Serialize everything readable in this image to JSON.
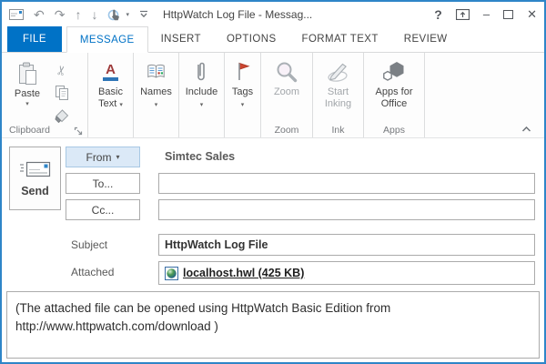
{
  "window": {
    "title": "HttpWatch Log File - Messag...",
    "controls": {
      "help": "?",
      "minimize": "–",
      "close": "✕"
    }
  },
  "glyphs": {
    "caret": "▾",
    "undo": "↶",
    "redo": "↷",
    "up": "↑",
    "down": "↓",
    "scissors": "✂"
  },
  "tabs": {
    "items": [
      {
        "label": "FILE"
      },
      {
        "label": "MESSAGE"
      },
      {
        "label": "INSERT"
      },
      {
        "label": "OPTIONS"
      },
      {
        "label": "FORMAT TEXT"
      },
      {
        "label": "REVIEW"
      }
    ]
  },
  "ribbon": {
    "clipboard": {
      "button": "Paste",
      "group": "Clipboard"
    },
    "basic_text": {
      "label": "Basic Text"
    },
    "names": {
      "label": "Names"
    },
    "include": {
      "label": "Include"
    },
    "tags": {
      "label": "Tags"
    },
    "zoom": {
      "button": "Zoom",
      "group": "Zoom"
    },
    "ink": {
      "button": "Start Inking",
      "group": "Ink"
    },
    "apps": {
      "button": "Apps for Office",
      "group": "Apps"
    }
  },
  "envelope": {
    "send": "Send",
    "from_button": "From",
    "from_value": "Simtec Sales",
    "to_button": "To...",
    "to_value": "",
    "cc_button": "Cc...",
    "cc_value": "",
    "subject_label": "Subject",
    "subject_value": "HttpWatch Log File",
    "attached_label": "Attached",
    "attachment_name": "localhost.hwl (425 KB)"
  },
  "body": {
    "text": "(The attached file can be opened using HttpWatch Basic Edition from http://www.httpwatch.com/download )"
  },
  "colors": {
    "accent_blue": "#0072c6",
    "window_border": "#2e85c8",
    "flag_red": "#cd4631"
  }
}
